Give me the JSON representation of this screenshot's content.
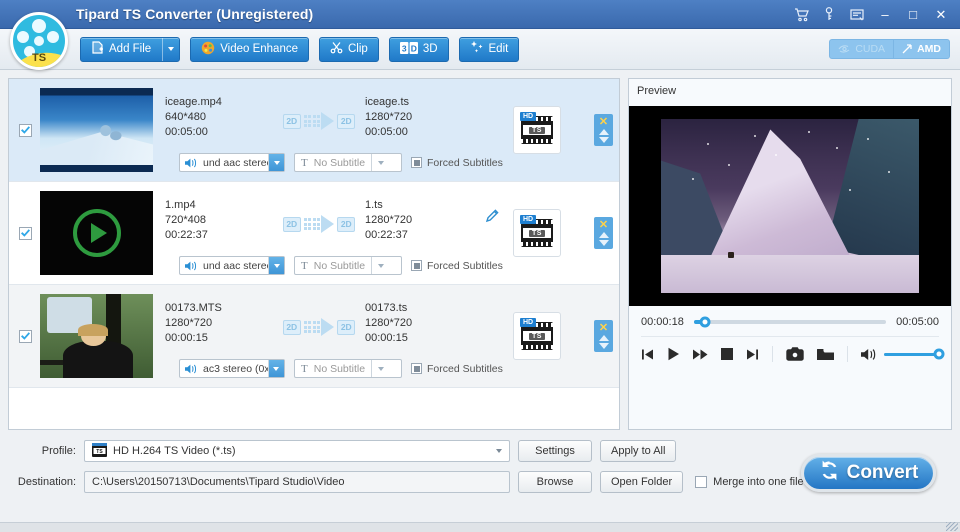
{
  "window": {
    "title": "Tipard TS Converter (Unregistered)",
    "logo_text": "TS",
    "title_icons": [
      "cart-icon",
      "key-icon",
      "register-icon"
    ],
    "minimize": "–",
    "maximize": "□",
    "close": "✕",
    "accent_color": "#2f9fe0",
    "titlebar_color": "#3a69ad"
  },
  "toolbar": {
    "add_file": "Add File",
    "video_enhance": "Video Enhance",
    "clip": "Clip",
    "three_d": "3D",
    "edit": "Edit",
    "cuda": "CUDA",
    "amd": "AMD"
  },
  "filelist": {
    "rows": [
      {
        "checked": true,
        "selected": true,
        "thumb": "iceage-thumbnail",
        "source_name": "iceage.mp4",
        "source_res": "640*480",
        "source_dur": "00:05:00",
        "in_3d": "2D",
        "out_3d": "2D",
        "out_name": "iceage.ts",
        "out_res": "1280*720",
        "out_dur": "00:05:00",
        "format_hd": "HD",
        "format_ts": "TS",
        "audio": "und aac stereo",
        "subtitle": "No Subtitle",
        "forced": "Forced Subtitles",
        "has_pencil": false
      },
      {
        "checked": true,
        "selected": false,
        "thumb": "play-button-thumbnail",
        "source_name": "1.mp4",
        "source_res": "720*408",
        "source_dur": "00:22:37",
        "in_3d": "2D",
        "out_3d": "2D",
        "out_name": "1.ts",
        "out_res": "1280*720",
        "out_dur": "00:22:37",
        "format_hd": "HD",
        "format_ts": "TS",
        "audio": "und aac stereo",
        "subtitle": "No Subtitle",
        "forced": "Forced Subtitles",
        "has_pencil": true
      },
      {
        "checked": true,
        "selected": false,
        "thumb": "boy-photo-thumbnail",
        "source_name": "00173.MTS",
        "source_res": "1280*720",
        "source_dur": "00:00:15",
        "in_3d": "2D",
        "out_3d": "2D",
        "out_name": "00173.ts",
        "out_res": "1280*720",
        "out_dur": "00:00:15",
        "format_hd": "HD",
        "format_ts": "TS",
        "audio": "ac3 stereo (0x",
        "subtitle": "No Subtitle",
        "forced": "Forced Subtitles",
        "has_pencil": false
      }
    ]
  },
  "preview": {
    "label": "Preview",
    "current_time": "00:00:18",
    "total_time": "00:05:00",
    "progress_percent": 6,
    "volume_percent": 100,
    "controls": [
      "previous-button",
      "play-button",
      "fast-forward-button",
      "stop-button",
      "next-button",
      "snapshot-button",
      "open-folder-button",
      "volume-icon"
    ]
  },
  "bottom": {
    "profile_label": "Profile:",
    "profile_value": "HD H.264 TS Video (*.ts)",
    "destination_label": "Destination:",
    "destination_value": "C:\\Users\\20150713\\Documents\\Tipard Studio\\Video",
    "settings": "Settings",
    "apply_to_all": "Apply to All",
    "browse": "Browse",
    "open_folder": "Open Folder",
    "merge": "Merge into one file",
    "merge_checked": false,
    "convert": "Convert"
  }
}
